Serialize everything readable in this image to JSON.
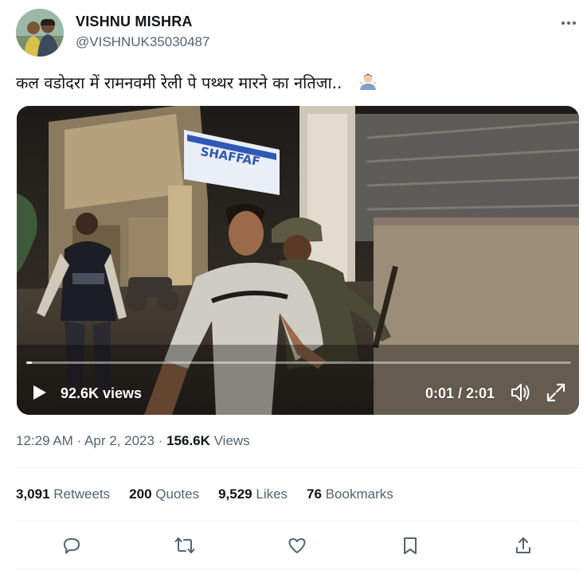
{
  "user": {
    "display_name": "VISHNU MISHRA",
    "handle": "@VISHNUK35030487",
    "avatar": "profile-photo-two-men"
  },
  "tweet": {
    "text": "कल वडोदरा में रामनवमी रेली पे पथ्थर मारने का नतिजा..",
    "emoji": "man-shrugging"
  },
  "video": {
    "views_label": "92.6K views",
    "time_label": "0:01 / 2:01",
    "progress_fraction": 0.01,
    "sign_text": "SHAFFAF"
  },
  "meta": {
    "time": "12:29 AM",
    "separator": "·",
    "date": "Apr 2, 2023",
    "views_count": "156.6K",
    "views_label": "Views"
  },
  "stats": [
    {
      "count": "3,091",
      "label": "Retweets"
    },
    {
      "count": "200",
      "label": "Quotes"
    },
    {
      "count": "9,529",
      "label": "Likes"
    },
    {
      "count": "76",
      "label": "Bookmarks"
    }
  ],
  "actions": [
    "reply-icon",
    "retweet-icon",
    "like-icon",
    "bookmark-icon",
    "share-icon"
  ],
  "colors": {
    "text_primary": "#0f1419",
    "text_secondary": "#536471",
    "divider": "#eff3f4"
  }
}
